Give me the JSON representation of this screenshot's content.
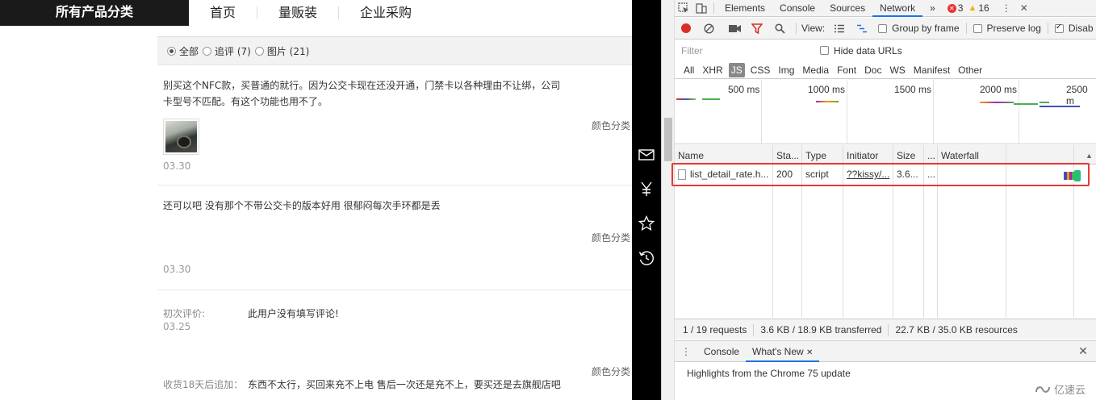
{
  "shop": {
    "category_label": "所有产品分类",
    "nav": [
      "首页",
      "量贩装",
      "企业采购"
    ],
    "filters": [
      {
        "label": "全部",
        "checked": true
      },
      {
        "label": "追评 (7)",
        "checked": false
      },
      {
        "label": "图片 (21)",
        "checked": false
      }
    ],
    "reviews": [
      {
        "text": "别买这个NFC款，买普通的就行。因为公交卡现在还没开通，门禁卡以各种理由不让绑，公司卡型号不匹配。有这个功能也用不了。",
        "color": "颜色分类",
        "date": "03.30"
      },
      {
        "text": "还可以吧 没有那个不带公交卡的版本好用 很郁闷每次手环都是丢",
        "color": "颜色分类",
        "date": "03.30"
      },
      {
        "label": "初次评价:",
        "content": "此用户没有填写评论!",
        "date": "03.25",
        "color": "颜色分类",
        "append_label": "收货18天后追加：",
        "append_content": "东西不太行，买回来充不上电 售后一次还是充不上，要买还是去旗舰店吧"
      }
    ]
  },
  "devtools": {
    "tabs": [
      "Elements",
      "Console",
      "Sources",
      "Network"
    ],
    "active_tab": "Network",
    "more": "»",
    "errors": "3",
    "warnings": "16",
    "toolbar": {
      "view_label": "View:",
      "group_by_frame": "Group by frame",
      "preserve_log": "Preserve log",
      "disable_cache": "Disab"
    },
    "filter_placeholder": "Filter",
    "hide_data_urls": "Hide data URLs",
    "types": [
      "All",
      "XHR",
      "JS",
      "CSS",
      "Img",
      "Media",
      "Font",
      "Doc",
      "WS",
      "Manifest",
      "Other"
    ],
    "active_type": "JS",
    "overview_ticks": [
      "500 ms",
      "1000 ms",
      "1500 ms",
      "2000 ms",
      "2500 m"
    ],
    "columns": [
      "Name",
      "Sta...",
      "Type",
      "Initiator",
      "Size",
      "...",
      "Waterfall"
    ],
    "rows": [
      {
        "name": "list_detail_rate.h...",
        "status": "200",
        "type": "script",
        "initiator": "??kissy/...",
        "size": "3.6...",
        "time": "..."
      }
    ],
    "status_bar": [
      "1 / 19 requests",
      "3.6 KB / 18.9 KB transferred",
      "22.7 KB / 35.0 KB resources"
    ],
    "drawer_tabs": [
      "Console",
      "What's New"
    ],
    "drawer_active": "What's New",
    "drawer_text": "Highlights from the Chrome 75 update",
    "watermark": "亿速云"
  }
}
